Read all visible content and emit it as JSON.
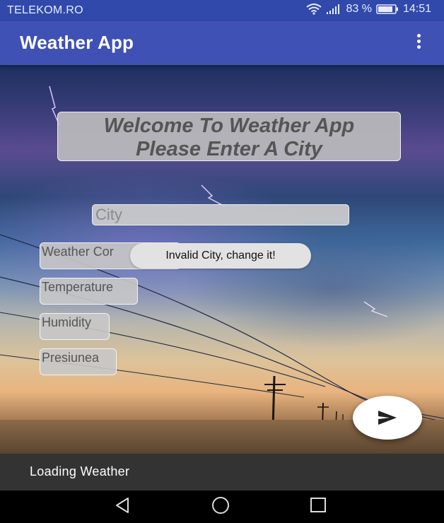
{
  "status_bar": {
    "carrier": "TELEKOM.RO",
    "battery_percent": "83 %",
    "time": "14:51",
    "icons": [
      "wifi-icon",
      "signal-icon",
      "battery-icon"
    ]
  },
  "app_bar": {
    "title": "Weather App",
    "menu_icon": "more-vert-icon"
  },
  "welcome": {
    "line1": "Welcome To Weather App",
    "line2": "Please Enter A City"
  },
  "city_input": {
    "placeholder": "City",
    "value": ""
  },
  "fields": {
    "condition": "Weather Cor",
    "temperature": "Temperature",
    "humidity": "Humidity",
    "pressure": "Presiunea"
  },
  "toast": {
    "message": "Invalid City, change it!"
  },
  "fab": {
    "icon": "send-icon"
  },
  "loading_bar": {
    "text": "Loading Weather"
  },
  "nav_bar": {
    "icons": [
      "back-icon",
      "home-icon",
      "recents-icon"
    ]
  },
  "colors": {
    "primary": "#3f51b5",
    "primary_dark": "#3049ab",
    "loading_bar": "#333333",
    "toast_bg": "#e2e2e2"
  }
}
